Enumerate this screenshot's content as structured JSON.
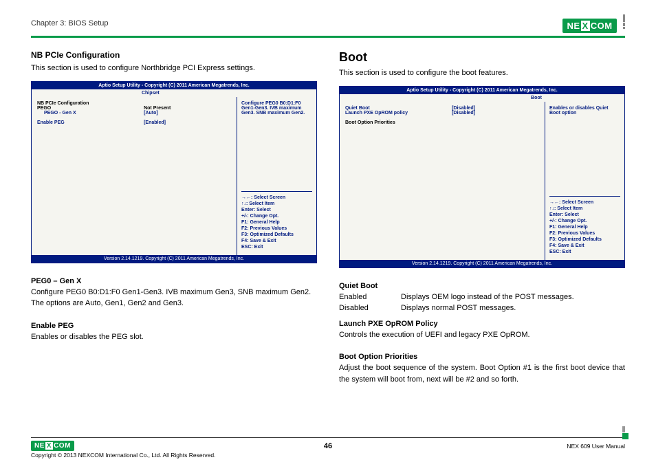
{
  "header": {
    "chapter": "Chapter 3: BIOS Setup",
    "logo_text_1": "NE",
    "logo_text_x": "X",
    "logo_text_2": "COM"
  },
  "left": {
    "title": "NB PCIe Configuration",
    "intro": "This section is used to configure Northbridge PCI Express settings.",
    "bios": {
      "title": "Aptio Setup Utility - Copyright (C) 2011 American Megatrends, Inc.",
      "tab": "Chipset",
      "rows": [
        {
          "k": "NB PCIe Configuration",
          "v": "",
          "cls": ""
        },
        {
          "k": "PEGO",
          "v": "Not Present",
          "cls": ""
        },
        {
          "k": "PEGO - Gen X",
          "v": "[Auto]",
          "cls": "c-blue indent"
        },
        {
          "k": "",
          "v": "",
          "cls": ""
        },
        {
          "k": "Enable PEG",
          "v": "[Enabled]",
          "cls": "c-blue"
        }
      ],
      "help": "Configure PEG0 B0:D1:F0 Gen1-Gen3. IVB maximum Gen3. SNB maximum Gen2.",
      "keys": [
        "→←: Select Screen",
        "↑↓: Select Item",
        "Enter: Select",
        "+/-: Change Opt.",
        "F1: General Help",
        "F2: Previous Values",
        "F3: Optimized Defaults",
        "F4: Save & Exit",
        "ESC: Exit"
      ],
      "footer": "Version 2.14.1219. Copyright (C) 2011 American Megatrends, Inc."
    },
    "sub1_title": "PEG0 – Gen X",
    "sub1_body": "Configure PEG0 B0:D1:F0 Gen1-Gen3. IVB maximum Gen3, SNB maximum Gen2. The options are Auto, Gen1, Gen2 and Gen3.",
    "sub2_title": "Enable PEG",
    "sub2_body": "Enables or disables the PEG slot."
  },
  "right": {
    "title": "Boot",
    "intro": "This section is used to configure the boot features.",
    "bios": {
      "title": "Aptio Setup Utility - Copyright (C) 2011 American Megatrends, Inc.",
      "tab": "Boot",
      "rows": [
        {
          "k": "Quiet Boot",
          "v": "[Disabled]",
          "cls": "c-blue"
        },
        {
          "k": "Launch PXE OpROM policy",
          "v": "[Disabled]",
          "cls": "c-blue"
        },
        {
          "k": "",
          "v": "",
          "cls": ""
        },
        {
          "k": "Boot Option Priorities",
          "v": "",
          "cls": ""
        }
      ],
      "help": "Enables or disables Quiet Boot option",
      "keys": [
        "→←: Select Screen",
        "↑↓: Select Item",
        "Enter: Select",
        "+/-: Change Opt.",
        "F1: General Help",
        "F2: Previous Values",
        "F3: Optimized Defaults",
        "F4: Save & Exit",
        "ESC: Exit"
      ],
      "footer": "Version 2.14.1219. Copyright (C) 2011 American Megatrends, Inc."
    },
    "sub1_title": "Quiet Boot",
    "def1": {
      "term": "Enabled",
      "desc": "Displays OEM logo instead of the POST messages."
    },
    "def2": {
      "term": "Disabled",
      "desc": "Displays normal POST messages."
    },
    "sub2_title": "Launch PXE OpROM Policy",
    "sub2_body": "Controls the execution of UEFI and legacy PXE OpROM.",
    "sub3_title": "Boot Option Priorities",
    "sub3_body": "Adjust the boot sequence of the system. Boot Option #1 is the first boot device that the system will boot from, next will be #2 and so forth."
  },
  "footer": {
    "copyright": "Copyright © 2013 NEXCOM International Co., Ltd. All Rights Reserved.",
    "pagenum": "46",
    "manual": "NEX 609 User Manual"
  }
}
